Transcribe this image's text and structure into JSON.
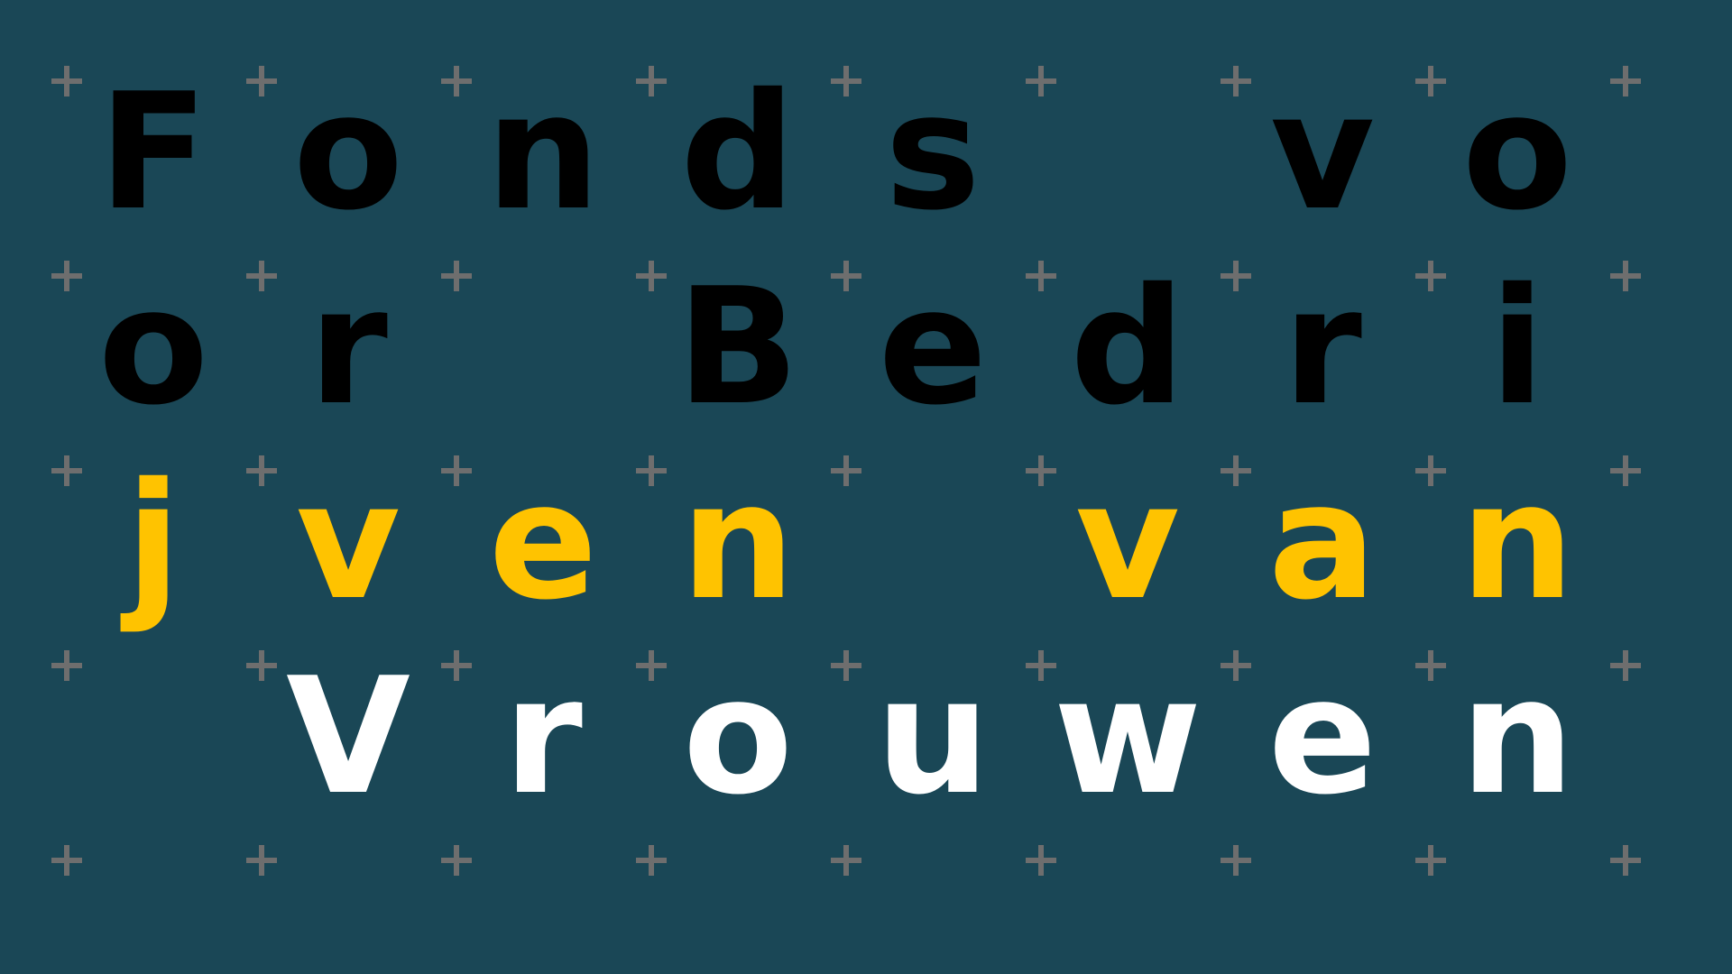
{
  "colors": {
    "background": "#1a4756",
    "plus": "#6e6e6e",
    "line1": "#000000",
    "line2": "#000000",
    "line3_j": "#ffc300",
    "line3": "#ffc300",
    "line4": "#ffffff"
  },
  "lines": [
    {
      "color_key": "line1",
      "cells": [
        "F",
        "o",
        "n",
        "d",
        "s",
        " ",
        "v",
        "o"
      ]
    },
    {
      "color_key": "line2",
      "cells": [
        "o",
        "r",
        " ",
        "B",
        "e",
        "d",
        "r",
        "i"
      ]
    },
    {
      "color_key": "line3",
      "cells": [
        "j",
        "v",
        "e",
        "n",
        " ",
        "v",
        "a",
        "n"
      ]
    },
    {
      "color_key": "line4",
      "cells": [
        " ",
        "V",
        "r",
        "o",
        "u",
        "w",
        "e",
        "n"
      ]
    }
  ]
}
